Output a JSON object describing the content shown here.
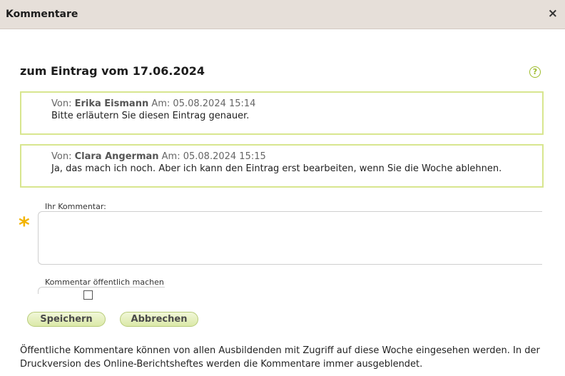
{
  "dialog": {
    "title": "Kommentare",
    "close_glyph": "×"
  },
  "heading": "zum Eintrag vom 17.06.2024",
  "help_glyph": "?",
  "comments": [
    {
      "from_label": "Von:",
      "author": "Erika Eismann",
      "date_label": "Am:",
      "datetime": "05.08.2024 15:14",
      "text": "Bitte erläutern Sie diesen Eintrag genauer."
    },
    {
      "from_label": "Von:",
      "author": "Clara Angerman",
      "date_label": "Am:",
      "datetime": "05.08.2024 15:15",
      "text": "Ja, das mach ich noch. Aber ich kann den Eintrag erst bearbeiten, wenn Sie die Woche ablehnen."
    }
  ],
  "form": {
    "comment_label": "Ihr Kommentar:",
    "comment_value": "",
    "required_glyph": "*",
    "public_label": "Kommentar öffentlich machen",
    "public_checked": false
  },
  "buttons": {
    "save": "Speichern",
    "cancel": "Abbrechen"
  },
  "note": "Öffentliche Kommentare können von allen Ausbildenden mit Zugriff auf diese Woche eingesehen werden. In der Druckversion des Online-Berichtsheftes werden die Kommentare immer ausgeblendet.",
  "colors": {
    "titlebar_bg": "#e6dfd9",
    "accent_green": "#9dbb2a",
    "comment_border": "#d8e68f",
    "required_star": "#f2b300"
  }
}
